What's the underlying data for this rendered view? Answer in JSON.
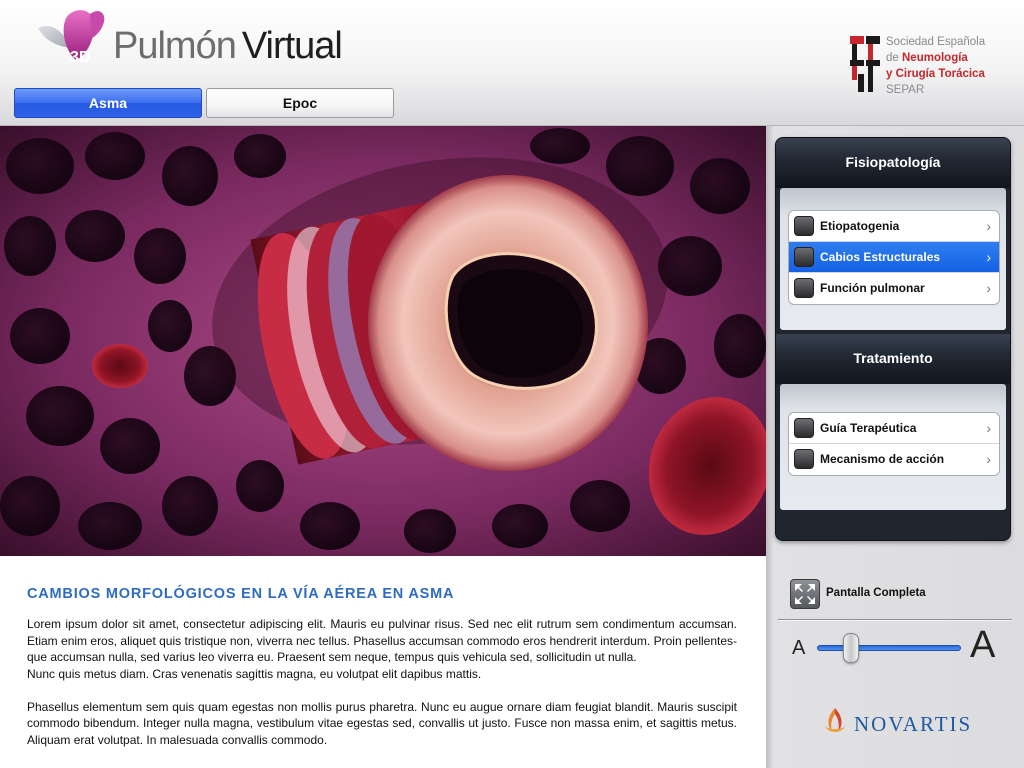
{
  "header": {
    "logo_badge": "3D",
    "logo_word_1": "Pulmón",
    "logo_word_2": "Virtual",
    "tabs": [
      {
        "label": "Asma",
        "selected": true
      },
      {
        "label": "Epoc",
        "selected": false
      }
    ],
    "society": {
      "line1": "Sociedad Española",
      "line2_prefix": "de ",
      "line2_bold": "Neumología",
      "line3": "y Cirugía Torácica",
      "line4": "SEPAR"
    }
  },
  "article": {
    "title": "CAMBIOS MORFOLÓGICOS EN LA VÍA AÉREA EN ASMA",
    "paragraph1": "Lorem ipsum dolor sit amet, consectetur adipiscing elit. Mauris eu pulvinar risus. Sed nec elit rutrum sem condimentum accumsan. Etiam enim eros, aliquet quis tristique non, viverra nec tellus. Phasellus accumsan commodo eros hendrerit interdum. Proin pellentes-que accumsan nulla, sed varius leo viverra eu. Praesent sem neque, tempus quis vehicula sed, sollicitudin ut nulla.",
    "paragraph1b": "Nunc quis metus diam. Cras venenatis sagittis magna, eu volutpat elit dapibus mattis.",
    "paragraph2": "Phasellus elementum sem quis quam egestas non mollis purus pharetra. Nunc eu augue ornare diam feugiat blandit. Mauris suscipit commodo bibendum. Integer nulla magna, vestibulum vitae egestas sed, convallis ut justo. Fusce non massa enim, et sagittis metus. Aliquam erat volutpat. In malesuada convallis commodo."
  },
  "sidebar": {
    "fisiopatologia": {
      "title": "Fisiopatología",
      "items": [
        {
          "label": "Etiopatogenia",
          "icon": "lungs-icon",
          "selected": false
        },
        {
          "label": "Cabios Estructurales",
          "icon": "structure-icon",
          "selected": true
        },
        {
          "label": "Función pulmonar",
          "icon": "spirometer-icon",
          "selected": false
        }
      ]
    },
    "tratamiento": {
      "title": "Tratamiento",
      "items": [
        {
          "label": "Guía Terapéutica",
          "icon": "stethoscope-icon",
          "selected": false
        },
        {
          "label": "Mecanismo de acción",
          "icon": "inhaler-icon",
          "selected": false
        }
      ]
    },
    "fullscreen_label": "Pantalla Completa",
    "font_size": {
      "small_label": "A",
      "large_label": "A",
      "level": 0.2
    },
    "sponsor": "NOVARTIS"
  },
  "colors": {
    "accent_blue": "#2e6cc1",
    "selected_blue": "#1561e4",
    "separ_red": "#c4272c",
    "novartis_blue": "#1f5aa3"
  }
}
